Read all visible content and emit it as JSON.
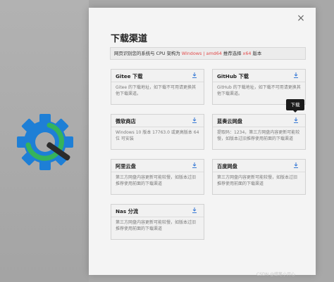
{
  "dialog": {
    "close_icon": "×",
    "title": "下载渠道",
    "info": {
      "prefix": "网页识别您的系统与 CPU 架构为",
      "os_arch": "Windows | amd64",
      "middle": "推荐选择",
      "recommend": "x64",
      "suffix": "版本"
    }
  },
  "channels": [
    {
      "title": "Gitee 下载",
      "icon": "download-icon",
      "description": "Gitee 的下载地址，如下载不可用请更换其他下载渠道。"
    },
    {
      "title": "GitHub 下载",
      "icon": "download-icon",
      "description": "GitHub 的下载地址，如下载不可用请更换其他下载渠道。"
    },
    {
      "title": "微软商店",
      "icon": "download-icon",
      "description": "Windows 10 版本 17763.0 或更高版本 64位 可安装"
    },
    {
      "title": "蓝奏云网盘",
      "icon": "download-icon",
      "description": "提取码：1234，第三方网盘内容更新可能较慢，如版本过旧推荐使用前面的下载渠道"
    },
    {
      "title": "阿里云盘",
      "icon": "download-icon",
      "description": "第三方网盘内容更新可能较慢，如版本过旧推荐使用前面的下载渠道"
    },
    {
      "title": "百度网盘",
      "icon": "download-icon",
      "description": "第三方网盘内容更新可能较慢，如版本过旧推荐使用前面的下载渠道"
    },
    {
      "title": "Nas 分流",
      "icon": "download-icon",
      "description": "第三方网盘内容更新可能较慢，如版本过旧推荐使用前面的下载渠道"
    }
  ],
  "tooltip": {
    "text": "下载"
  },
  "watermark": "CSDN @蜡笔小开心",
  "colors": {
    "highlight": "#e24a4a",
    "logo_blue": "#1e7fd6",
    "logo_green": "#35b35b"
  }
}
